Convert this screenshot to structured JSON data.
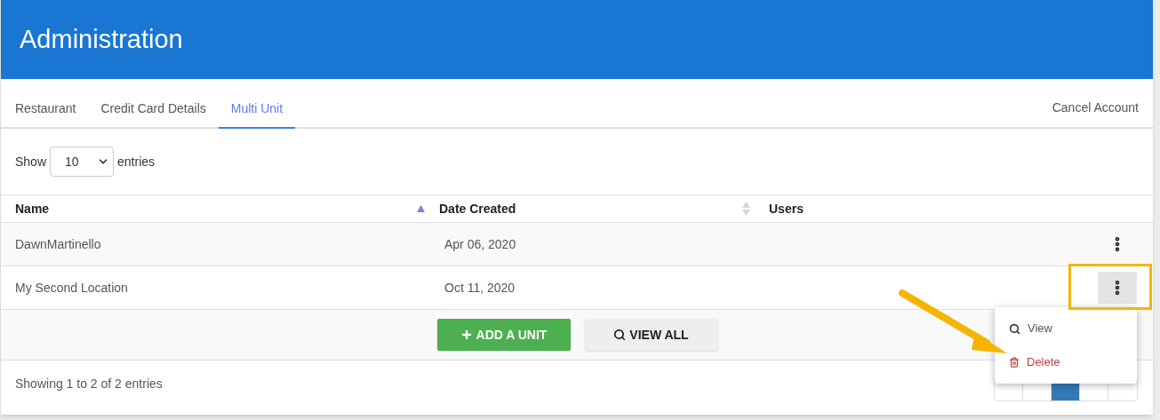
{
  "header": {
    "title": "Administration"
  },
  "tabs": [
    {
      "label": "Restaurant",
      "selected": false
    },
    {
      "label": "Credit Card Details",
      "selected": false
    },
    {
      "label": "Multi Unit",
      "selected": true
    }
  ],
  "cancel_link": "Cancel Account",
  "length_control": {
    "before": "Show",
    "value": "10",
    "after": "entries"
  },
  "table": {
    "columns": [
      {
        "label": "Name",
        "sortable": true,
        "sorted": true
      },
      {
        "label": "Date Created",
        "sortable": true,
        "sorted": false
      },
      {
        "label": "Users"
      }
    ],
    "rows": [
      {
        "cells": [
          "DawnMartinello",
          "Apr 06, 2020"
        ],
        "menu_open": false
      },
      {
        "cells": [
          "My Second Location",
          "Oct 11, 2020"
        ],
        "menu_open": true
      }
    ]
  },
  "buttons": [
    {
      "kind": "add",
      "label": "ADD A UNIT"
    },
    {
      "kind": "view",
      "label": "VIEW ALL"
    }
  ],
  "info": "Showing 1 to 2 of 2 entries",
  "pagination": [
    {
      "selected": false
    },
    {
      "selected": false
    },
    {
      "selected": true
    },
    {
      "selected": false
    },
    {
      "selected": false
    }
  ],
  "row_menu": [
    {
      "kind": "view",
      "label": "View"
    },
    {
      "kind": "delete",
      "label": "Delete"
    }
  ]
}
